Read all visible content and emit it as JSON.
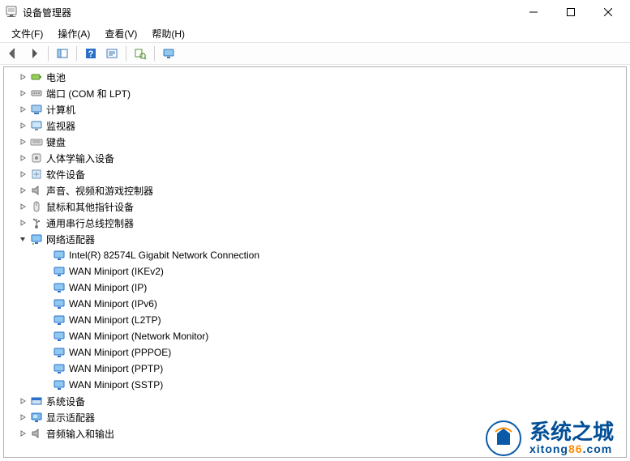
{
  "window": {
    "title": "设备管理器"
  },
  "menus": {
    "file": "文件(F)",
    "action": "操作(A)",
    "view": "查看(V)",
    "help": "帮助(H)"
  },
  "toolbar_icons": [
    "back-icon",
    "forward-icon",
    "show-hide-icon",
    "help-icon",
    "properties-icon",
    "scan-hardware-icon",
    "monitor-icon"
  ],
  "tree": {
    "categories": [
      {
        "id": "battery",
        "icon": "battery-icon",
        "label": "电池",
        "expanded": false
      },
      {
        "id": "ports",
        "icon": "port-icon",
        "label": "端口 (COM 和 LPT)",
        "expanded": false
      },
      {
        "id": "computer",
        "icon": "computer-icon",
        "label": "计算机",
        "expanded": false
      },
      {
        "id": "monitors",
        "icon": "monitor-icon",
        "label": "监视器",
        "expanded": false
      },
      {
        "id": "keyboards",
        "icon": "keyboard-icon",
        "label": "键盘",
        "expanded": false
      },
      {
        "id": "hid",
        "icon": "hid-icon",
        "label": "人体学输入设备",
        "expanded": false
      },
      {
        "id": "software-dev",
        "icon": "software-icon",
        "label": "软件设备",
        "expanded": false
      },
      {
        "id": "sound",
        "icon": "speaker-icon",
        "label": "声音、视频和游戏控制器",
        "expanded": false
      },
      {
        "id": "mice",
        "icon": "mouse-icon",
        "label": "鼠标和其他指针设备",
        "expanded": false
      },
      {
        "id": "usb",
        "icon": "usb-icon",
        "label": "通用串行总线控制器",
        "expanded": false
      },
      {
        "id": "network",
        "icon": "network-icon",
        "label": "网络适配器",
        "expanded": true,
        "children": [
          {
            "label": "Intel(R) 82574L Gigabit Network Connection"
          },
          {
            "label": "WAN Miniport (IKEv2)"
          },
          {
            "label": "WAN Miniport (IP)"
          },
          {
            "label": "WAN Miniport (IPv6)"
          },
          {
            "label": "WAN Miniport (L2TP)"
          },
          {
            "label": "WAN Miniport (Network Monitor)"
          },
          {
            "label": "WAN Miniport (PPPOE)"
          },
          {
            "label": "WAN Miniport (PPTP)"
          },
          {
            "label": "WAN Miniport (SSTP)"
          }
        ]
      },
      {
        "id": "system",
        "icon": "system-icon",
        "label": "系统设备",
        "expanded": false
      },
      {
        "id": "display",
        "icon": "display-icon",
        "label": "显示适配器",
        "expanded": false
      },
      {
        "id": "audio-io",
        "icon": "speaker-icon",
        "label": "音频输入和输出",
        "expanded": false
      }
    ]
  },
  "watermark": {
    "cn": "系统之城",
    "en_prefix": "xitong",
    "en_accent": "86",
    "en_suffix": ".com"
  }
}
